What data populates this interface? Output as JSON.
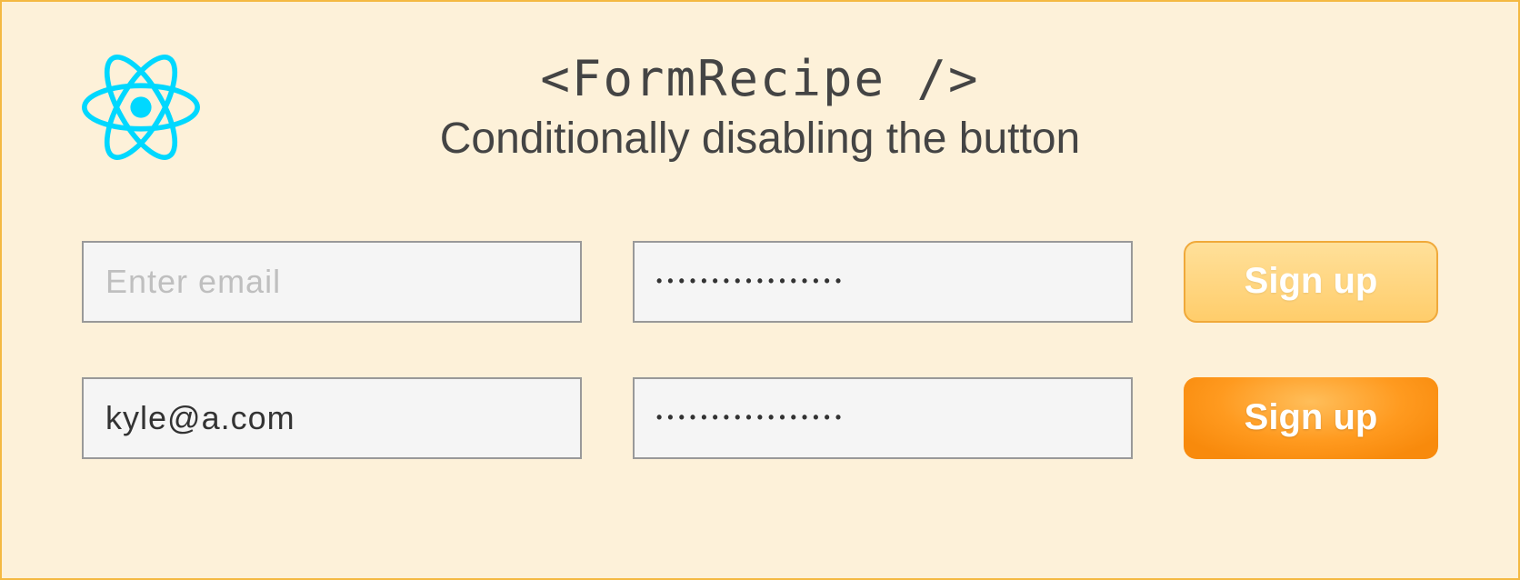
{
  "title": "<FormRecipe />",
  "subtitle": "Conditionally disabling the button",
  "row1": {
    "email_placeholder": "Enter email",
    "email_value": "",
    "password_value": "•••••••••••••••••",
    "button_label": "Sign up"
  },
  "row2": {
    "email_value": "kyle@a.com",
    "password_value": "•••••••••••••••••",
    "button_label": "Sign up"
  }
}
